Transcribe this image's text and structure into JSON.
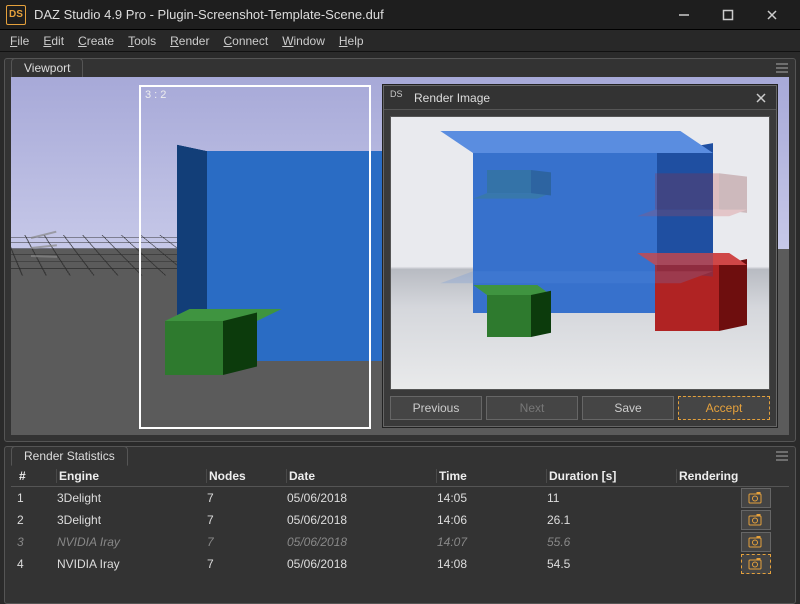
{
  "window": {
    "title": "DAZ Studio 4.9 Pro - Plugin-Screenshot-Template-Scene.duf"
  },
  "menu": [
    "File",
    "Edit",
    "Create",
    "Tools",
    "Render",
    "Connect",
    "Window",
    "Help"
  ],
  "viewport": {
    "tab": "Viewport",
    "ratio_label": "3 : 2"
  },
  "render_window": {
    "title": "Render Image",
    "buttons": {
      "previous": "Previous",
      "next": "Next",
      "save": "Save",
      "accept": "Accept"
    }
  },
  "stats": {
    "tab": "Render Statistics",
    "columns": [
      "#",
      "Engine",
      "Nodes",
      "Date",
      "Time",
      "Duration [s]",
      "Rendering"
    ],
    "rows": [
      {
        "n": "1",
        "engine": "3Delight",
        "nodes": "7",
        "date": "05/06/2018",
        "time": "14:05",
        "duration": "11",
        "dim": false
      },
      {
        "n": "2",
        "engine": "3Delight",
        "nodes": "7",
        "date": "05/06/2018",
        "time": "14:06",
        "duration": "26.1",
        "dim": false
      },
      {
        "n": "3",
        "engine": "NVIDIA Iray",
        "nodes": "7",
        "date": "05/06/2018",
        "time": "14:07",
        "duration": "55.6",
        "dim": true
      },
      {
        "n": "4",
        "engine": "NVIDIA Iray",
        "nodes": "7",
        "date": "05/06/2018",
        "time": "14:08",
        "duration": "54.5",
        "dim": false,
        "active": true
      }
    ]
  }
}
